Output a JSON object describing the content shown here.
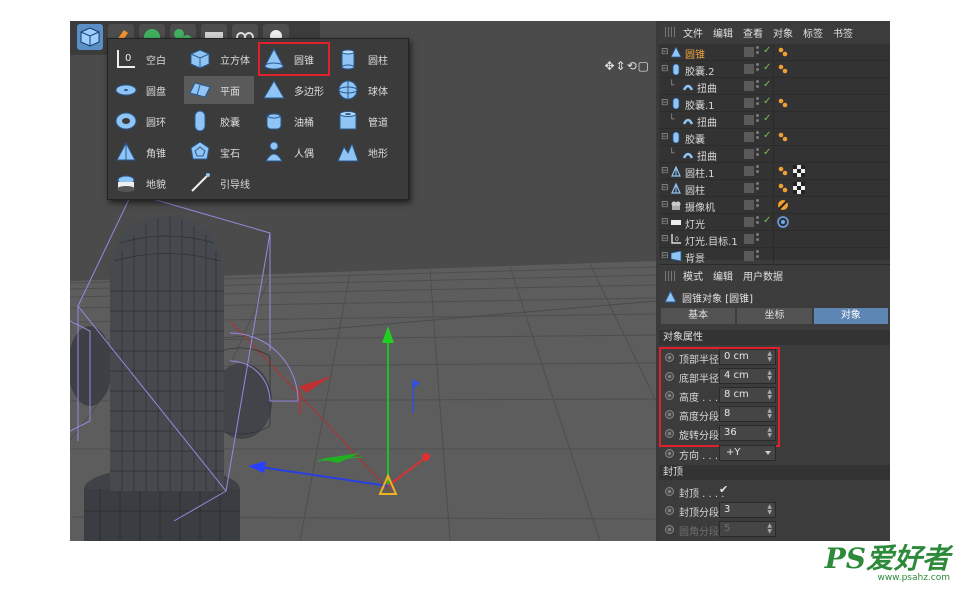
{
  "palette": {
    "col1": [
      {
        "label": "空白",
        "icon": "null-icon"
      },
      {
        "label": "圆盘",
        "icon": "disc-icon"
      },
      {
        "label": "圆环",
        "icon": "torus-icon"
      },
      {
        "label": "角锥",
        "icon": "pyramid-icon"
      },
      {
        "label": "地貌",
        "icon": "landscape-icon"
      }
    ],
    "col2": [
      {
        "label": "立方体",
        "icon": "cube-icon"
      },
      {
        "label": "平面",
        "icon": "plane-icon"
      },
      {
        "label": "胶囊",
        "icon": "capsule-icon"
      },
      {
        "label": "宝石",
        "icon": "platonic-icon"
      },
      {
        "label": "引导线",
        "icon": "guide-icon"
      }
    ],
    "col3": [
      {
        "label": "圆锥",
        "icon": "cone-icon"
      },
      {
        "label": "多边形",
        "icon": "polygon-icon"
      },
      {
        "label": "油桶",
        "icon": "oil-tank-icon"
      },
      {
        "label": "人偶",
        "icon": "figure-icon"
      }
    ],
    "col4": [
      {
        "label": "圆柱",
        "icon": "cylinder-icon"
      },
      {
        "label": "球体",
        "icon": "sphere-icon"
      },
      {
        "label": "管道",
        "icon": "tube-icon"
      },
      {
        "label": "地形",
        "icon": "landscape-mountain-icon"
      }
    ]
  },
  "object_manager": {
    "menu": [
      "文件",
      "编辑",
      "查看",
      "对象",
      "标签",
      "书签"
    ],
    "rows": [
      {
        "name": "圆锥",
        "indent": 0,
        "selected": true,
        "icon": "cone-icon",
        "check": true,
        "tags": [
          "phong"
        ]
      },
      {
        "name": "胶囊.2",
        "indent": 0,
        "selected": false,
        "icon": "capsule-icon",
        "check": true,
        "tags": [
          "phong"
        ]
      },
      {
        "name": "扭曲",
        "indent": 1,
        "selected": false,
        "icon": "bend-icon",
        "check": true,
        "tags": []
      },
      {
        "name": "胶囊.1",
        "indent": 0,
        "selected": false,
        "icon": "capsule-icon",
        "check": true,
        "tags": [
          "phong"
        ]
      },
      {
        "name": "扭曲",
        "indent": 1,
        "selected": false,
        "icon": "bend-icon",
        "check": true,
        "tags": []
      },
      {
        "name": "胶囊",
        "indent": 0,
        "selected": false,
        "icon": "capsule-icon",
        "check": true,
        "tags": [
          "phong"
        ]
      },
      {
        "name": "扭曲",
        "indent": 1,
        "selected": false,
        "icon": "bend-icon",
        "check": true,
        "tags": []
      },
      {
        "name": "圆柱.1",
        "indent": 0,
        "selected": false,
        "icon": "symmetry-icon",
        "check": false,
        "tags": [
          "phong",
          "checker"
        ]
      },
      {
        "name": "圆柱",
        "indent": 0,
        "selected": false,
        "icon": "symmetry-icon",
        "check": false,
        "tags": [
          "phong",
          "checker"
        ]
      },
      {
        "name": "摄像机",
        "indent": 0,
        "selected": false,
        "icon": "camera-icon",
        "check": false,
        "tags": [
          "protection"
        ]
      },
      {
        "name": "灯光",
        "indent": 0,
        "selected": false,
        "icon": "light-icon",
        "check": true,
        "tags": [
          "target"
        ]
      },
      {
        "name": "灯光.目标.1",
        "indent": 0,
        "selected": false,
        "icon": "null-icon",
        "check": false,
        "tags": []
      },
      {
        "name": "背景",
        "indent": 0,
        "selected": false,
        "icon": "background-icon",
        "check": false,
        "tags": []
      }
    ]
  },
  "attribute_manager": {
    "menu": [
      "模式",
      "编辑",
      "用户数据"
    ],
    "title": "圆锥对象 [圆锥]",
    "tabs": [
      "基本",
      "坐标",
      "对象"
    ],
    "active_tab": "对象",
    "section_object": "对象属性",
    "props": [
      {
        "label": "顶部半径",
        "value": "0 cm"
      },
      {
        "label": "底部半径",
        "value": "4 cm"
      },
      {
        "label": "高度 . . . .",
        "value": "8 cm"
      },
      {
        "label": "高度分段",
        "value": "8"
      },
      {
        "label": "旋转分段",
        "value": "36"
      }
    ],
    "orientation": {
      "label": "方向 . . . .",
      "value": "+Y"
    },
    "section_caps": "封顶",
    "caps": [
      {
        "label": "封顶 . . . .",
        "type": "check",
        "value": "✔"
      },
      {
        "label": "封顶分段",
        "type": "field",
        "value": "3"
      },
      {
        "label": "圆角分段",
        "type": "field",
        "value": "5",
        "dim": true
      }
    ]
  },
  "watermark": {
    "logo": "PS爱好者",
    "url": "www.psahz.com"
  },
  "colors": {
    "accent": "#5e86b4",
    "highlight_box": "#e0202a",
    "selected_text": "#f0a640",
    "mesh": "#454a50",
    "wire": "#9a88e0"
  }
}
